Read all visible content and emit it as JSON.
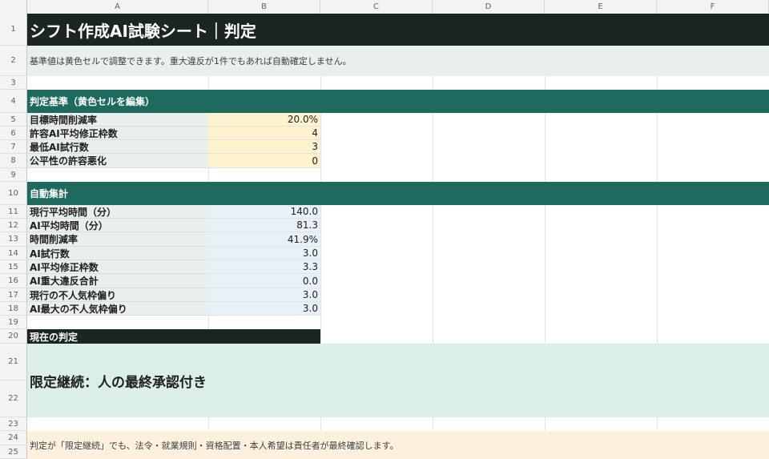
{
  "columns": [
    "A",
    "B",
    "C",
    "D",
    "E",
    "F"
  ],
  "rows": [
    "1",
    "2",
    "3",
    "4",
    "5",
    "6",
    "7",
    "8",
    "9",
    "10",
    "11",
    "12",
    "13",
    "14",
    "15",
    "16",
    "17",
    "18",
    "19",
    "20",
    "21",
    "22",
    "23",
    "24",
    "25"
  ],
  "title": "シフト作成AI試験シート｜判定",
  "note": "基準値は黄色セルで調整できます。重大違反が1件でもあれば自動確定しません。",
  "criteria": {
    "header": "判定基準（黄色セルを編集）",
    "items": [
      {
        "label": "目標時間削減率",
        "value": "20.0%"
      },
      {
        "label": "許容AI平均修正枠数",
        "value": "4"
      },
      {
        "label": "最低AI試行数",
        "value": "3"
      },
      {
        "label": "公平性の許容悪化",
        "value": "0"
      }
    ]
  },
  "summary": {
    "header": "自動集計",
    "items": [
      {
        "label": "現行平均時間（分）",
        "value": "140.0"
      },
      {
        "label": "AI平均時間（分）",
        "value": "81.3"
      },
      {
        "label": "時間削減率",
        "value": "41.9%"
      },
      {
        "label": "AI試行数",
        "value": "3.0"
      },
      {
        "label": "AI平均修正枠数",
        "value": "3.3"
      },
      {
        "label": "AI重大違反合計",
        "value": "0.0"
      },
      {
        "label": "現行の不人気枠偏り",
        "value": "3.0"
      },
      {
        "label": "AI最大の不人気枠偏り",
        "value": "3.0"
      }
    ]
  },
  "verdict": {
    "header": "現在の判定",
    "result": "限定継続：人の最終承認付き"
  },
  "footer": "判定が「限定継続」でも、法令・就業規則・資格配置・本人希望は責任者が最終確認します。",
  "colors": {
    "title_bg": "#1c2621",
    "section_bg": "#1e6a5f",
    "label_bg": "#e8efec",
    "input_yellow": "#fff3cf",
    "computed_blue": "#e8f1f7",
    "verdict_bg": "#dceee8",
    "footer_bg": "#fdf0dc"
  }
}
